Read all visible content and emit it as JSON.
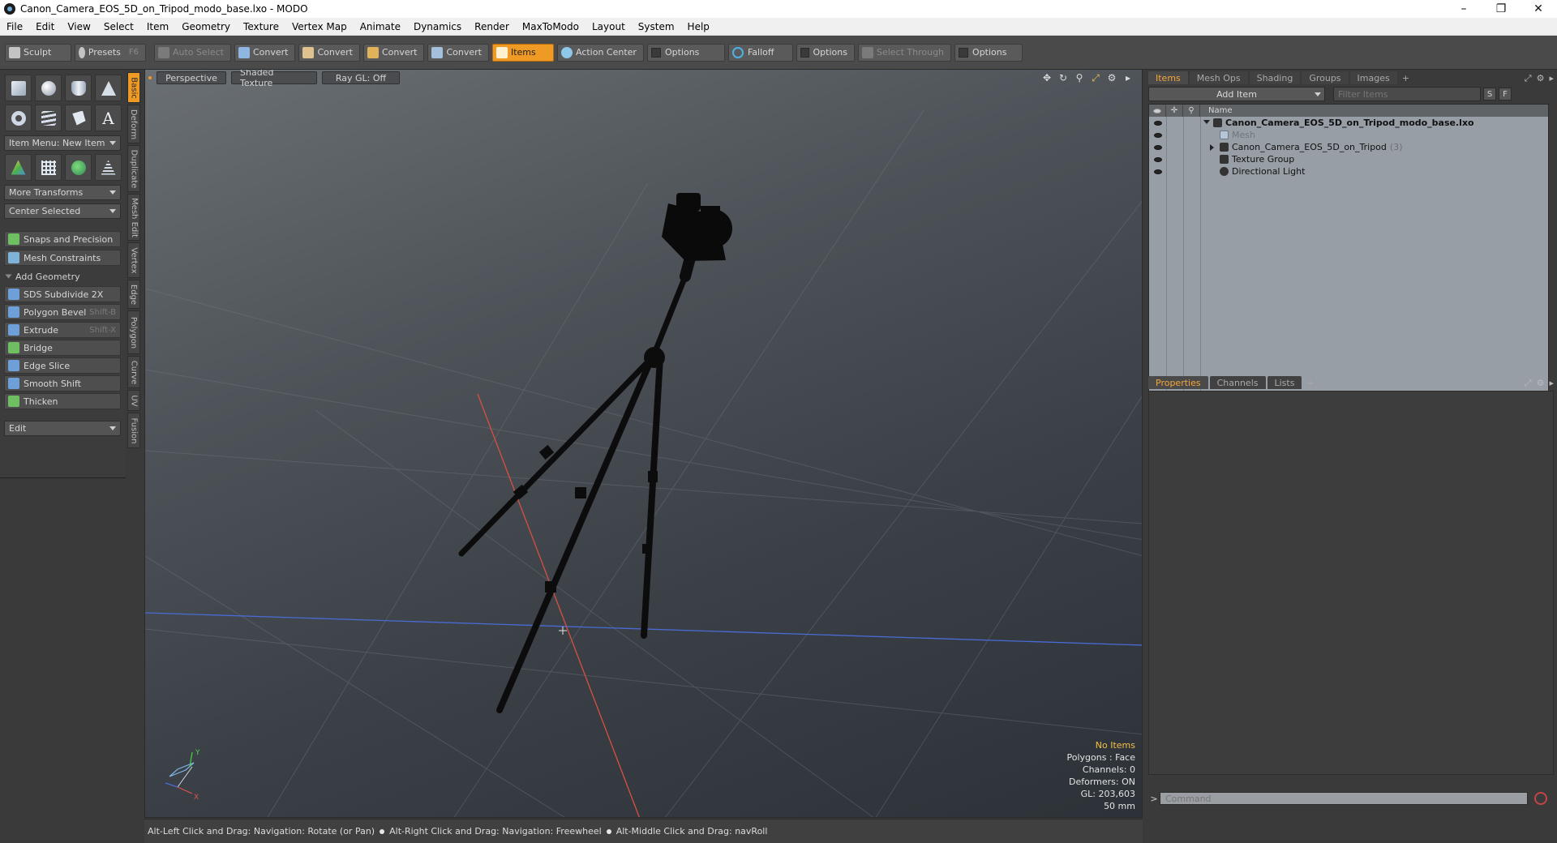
{
  "window": {
    "title": "Canon_Camera_EOS_5D_on_Tripod_modo_base.lxo - MODO",
    "controls": [
      "–",
      "❐",
      "✕"
    ]
  },
  "menu": [
    "File",
    "Edit",
    "View",
    "Select",
    "Item",
    "Geometry",
    "Texture",
    "Vertex Map",
    "Animate",
    "Dynamics",
    "Render",
    "MaxToModo",
    "Layout",
    "System",
    "Help"
  ],
  "toolbar": {
    "sculpt": "Sculpt",
    "presets": "Presets",
    "presets_key": "F6",
    "auto_select": "Auto Select",
    "convert1": "Convert",
    "convert2": "Convert",
    "convert3": "Convert",
    "convert4": "Convert",
    "items": "Items",
    "action_center": "Action Center",
    "options1": "Options",
    "falloff": "Falloff",
    "options2": "Options",
    "select_through": "Select Through",
    "options3": "Options"
  },
  "left_panel": {
    "item_menu": "Item Menu: New Item",
    "more_transforms": "More Transforms",
    "center_selected": "Center Selected",
    "snaps": "Snaps and Precision",
    "mesh_constraints": "Mesh Constraints",
    "add_geometry": "Add Geometry",
    "tools": [
      {
        "label": "SDS Subdivide 2X",
        "key": ""
      },
      {
        "label": "Polygon Bevel",
        "key": "Shift-B"
      },
      {
        "label": "Extrude",
        "key": "Shift-X"
      },
      {
        "label": "Bridge",
        "key": ""
      },
      {
        "label": "Edge Slice",
        "key": ""
      },
      {
        "label": "Smooth Shift",
        "key": ""
      },
      {
        "label": "Thicken",
        "key": ""
      }
    ],
    "edit_dropdown": "Edit"
  },
  "vertical_tabs": [
    "Basic",
    "Deform",
    "Duplicate",
    "Mesh Edit",
    "Vertex",
    "Edge",
    "Polygon",
    "Curve",
    "UV",
    "Fusion"
  ],
  "viewport": {
    "view": "Perspective",
    "shading": "Shaded Texture",
    "raygl": "Ray GL: Off",
    "info": {
      "no_items": "No Items",
      "polygons": "Polygons : Face",
      "channels": "Channels: 0",
      "deformers": "Deformers: ON",
      "gl": "GL: 203,603",
      "focal": "50 mm"
    }
  },
  "status": {
    "hint1": "Alt-Left Click and Drag: Navigation: Rotate (or Pan)",
    "hint2": "Alt-Right Click and Drag: Navigation: Freewheel",
    "hint3": "Alt-Middle Click and Drag: navRoll"
  },
  "items_panel": {
    "tabs": [
      "Items",
      "Mesh Ops",
      "Shading",
      "Groups",
      "Images"
    ],
    "add_item": "Add Item",
    "filter_placeholder": "Filter Items",
    "btn_s": "S",
    "btn_f": "F",
    "name_header": "Name",
    "rows": [
      {
        "label": "Canon_Camera_EOS_5D_on_Tripod_modo_base.lxo",
        "count": ""
      },
      {
        "label": "Mesh",
        "count": ""
      },
      {
        "label": "Canon_Camera_EOS_5D_on_Tripod",
        "count": "(3)"
      },
      {
        "label": "Texture Group",
        "count": ""
      },
      {
        "label": "Directional Light",
        "count": ""
      }
    ]
  },
  "properties_panel": {
    "tabs": [
      "Properties",
      "Channels",
      "Lists"
    ],
    "command_placeholder": "Command"
  },
  "colors": {
    "accent": "#f09a26",
    "x_axis": "#d9503f",
    "z_axis": "#4a6bd6"
  }
}
